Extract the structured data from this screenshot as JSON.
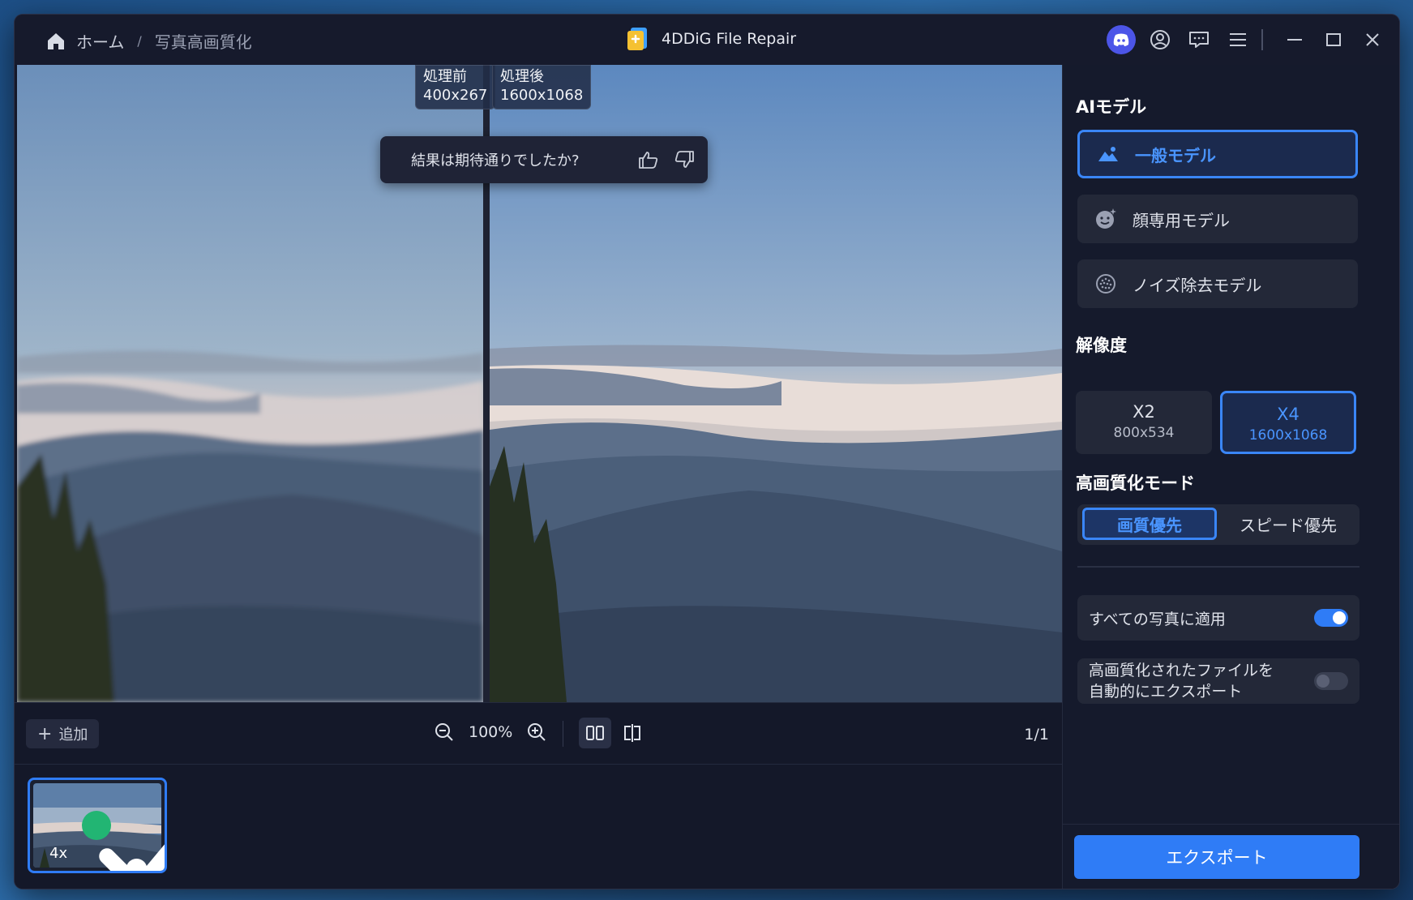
{
  "breadcrumb": {
    "home": "ホーム",
    "separator": "/",
    "current": "写真高画質化"
  },
  "app": {
    "title": "4DDiG File Repair"
  },
  "colors": {
    "accent": "#2f7cf6",
    "accent_text": "#4a95ff",
    "success": "#22b573",
    "discord": "#4c55e8"
  },
  "titlebar_icons": [
    "discord-icon",
    "account-icon",
    "feedback-icon",
    "menu-icon",
    "minimize-icon",
    "maximize-icon",
    "close-icon"
  ],
  "viewer": {
    "before_label": "処理前",
    "before_size": "400x267",
    "after_label": "処理後",
    "after_size": "1600x1068",
    "feedback_question": "結果は期待通りでしたか?"
  },
  "toolbar": {
    "add_label": "追加",
    "zoom_value": "100%",
    "page": "1/1"
  },
  "thumbnail": {
    "scale": "4x"
  },
  "panel": {
    "ai_model_title": "AIモデル",
    "models": [
      {
        "label": "一般モデル",
        "icon": "landscape-icon",
        "active": true
      },
      {
        "label": "顔専用モデル",
        "icon": "face-icon",
        "active": false
      },
      {
        "label": "ノイズ除去モデル",
        "icon": "noise-icon",
        "active": false
      }
    ],
    "resolution_title": "解像度",
    "resolutions": [
      {
        "scale": "X2",
        "size": "800x534",
        "active": false
      },
      {
        "scale": "X4",
        "size": "1600x1068",
        "active": true
      }
    ],
    "mode_title": "高画質化モード",
    "modes": [
      {
        "label": "画質優先",
        "active": true
      },
      {
        "label": "スピード優先",
        "active": false
      }
    ],
    "apply_all_label": "すべての写真に適用",
    "apply_all_on": true,
    "auto_export_line1": "高画質化されたファイルを",
    "auto_export_line2": "自動的にエクスポート",
    "auto_export_on": false,
    "export_label": "エクスポート"
  }
}
